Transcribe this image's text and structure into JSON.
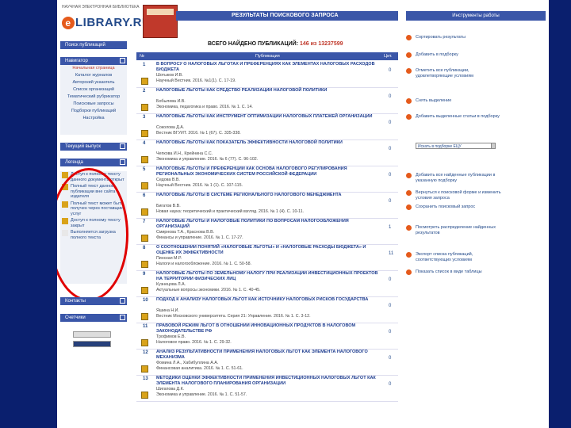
{
  "brand": {
    "tagline": "НАУЧНАЯ ЭЛЕКТРОННАЯ БИБЛИОТЕКА",
    "logo_text": "LIBRARY.RU",
    "logo_letter": "e"
  },
  "header": {
    "title": "РЕЗУЛЬТАТЫ ПОИСКОВОГО ЗАПРОСА",
    "right_title": "Инструменты работы"
  },
  "found": {
    "label": "ВСЕГО НАЙДЕНО ПУБЛИКАЦИЙ:",
    "count": "146 из 13237599"
  },
  "sidebar": {
    "search_button": "Поиск публикаций",
    "nav_button": "Навигатор",
    "nav_items": [
      {
        "label": "Начальная страница",
        "active": true
      },
      {
        "label": "Каталог журналов"
      },
      {
        "label": "Авторский указатель"
      },
      {
        "label": "Список организаций"
      },
      {
        "label": "Тематический рубрикатор"
      },
      {
        "label": "Поисковые запросы"
      },
      {
        "label": "Подборки публикаций"
      },
      {
        "label": "Настройка"
      }
    ],
    "current_button": "Текущий выпуск",
    "legend_button": "Легенда",
    "legend": [
      "Доступ к полному тексту данного документа открыт",
      "Полный текст данной публикации вне сайта издателя",
      "Полный текст может быть получен через поставщика услуг",
      "Доступ к полному тексту закрыт",
      "Выполняется загрузка полного текста"
    ],
    "contacts_button": "Контакты",
    "counter_button": "Счетчики"
  },
  "table": {
    "col_num": "№",
    "col_pub": "Публикация",
    "col_cit": "Цит.",
    "rows": [
      {
        "n": "1",
        "title": "В ВОПРОСУ О НАЛОГОВЫХ ЛЬГОТАХ И ПРЕФЕРЕНЦИЯХ КАК ЭЛЕМЕНТАХ НАЛОГОВЫХ РАСХОДОВ БЮДЖЕТА",
        "authors": "Шотыков И.В.",
        "src": "Научный Вестник. 2016. №1(1). С. 17-19.",
        "cit": "0"
      },
      {
        "n": "2",
        "title": "НАЛОГОВЫЕ ЛЬГОТЫ КАК СРЕДСТВО РЕАЛИЗАЦИИ НАЛОГОВОЙ ПОЛИТИКИ",
        "authors": "Бобылева И.В.",
        "src": "Экономика, педагогика и право. 2016. № 1. С. 14.",
        "cit": "0"
      },
      {
        "n": "3",
        "title": "НАЛОГОВЫЕ ЛЬГОТЫ КАК ИНСТРУМЕНТ ОПТИМИЗАЦИИ НАЛОГОВЫХ ПЛАТЕЖЕЙ ОРГАНИЗАЦИИ",
        "authors": "Соколова Д.А.",
        "src": "Вестник ВГУИТ. 2016. № 1 (67). С. 335-338.",
        "cit": "0"
      },
      {
        "n": "4",
        "title": "НАЛОГОВЫЕ ЛЬГОТЫ КАК ПОКАЗАТЕЛЬ ЭФФЕКТИВНОСТИ НАЛОГОВОЙ ПОЛИТИКИ",
        "authors": "Чепкова И.Н., Крейнина С.С.",
        "src": "Экономика и управление. 2016. № 6 (77). С. 96-102.",
        "cit": "0"
      },
      {
        "n": "5",
        "title": "НАЛОГОВЫЕ ЛЬГОТЫ И ПРЕФЕРЕНЦИИ КАК ОСНОВА НАЛОГОВОГО РЕГУЛИРОВАНИЯ РЕГИОНАЛЬНЫХ ЭКОНОМИЧЕСКИХ СИСТЕМ РОССИЙСКОЙ ФЕДЕРАЦИИ",
        "authors": "Седова В.В.",
        "src": "Научный Вестник. 2016. № 1 (1). С. 107-115.",
        "cit": "0"
      },
      {
        "n": "6",
        "title": "НАЛОГОВЫЕ ЛЬГОТЫ В СИСТЕМЕ РЕГИОНАЛЬНОГО НАЛОГОВОГО МЕНЕДЖМЕНТА",
        "authors": "Бигатов В.В.",
        "src": "Новая наука: теоретический и практический взгляд. 2016. № 1 (4). С. 10-11.",
        "cit": "0"
      },
      {
        "n": "7",
        "title": "НАЛОГОВЫЕ ЛЬГОТЫ И НАЛОГОВЫЕ ПОЛИТИКИ ПО ВОПРОСАМ НАЛОГООБЛОЖЕНИЯ ОРГАНИЗАЦИЙ",
        "authors": "Смирнова Т.А., Краснова В.В.",
        "src": "Финансы и управление. 2016. № 1. С. 17-27.",
        "cit": "1"
      },
      {
        "n": "8",
        "title": "О СООТНОШЕНИИ ПОНЯТИЙ «НАЛОГОВЫЕ ЛЬГОТЫ» И «НАЛОГОВЫЕ РАСХОДЫ БЮДЖЕТА» И ОЦЕНКЕ ИХ ЭФФЕКТИВНОСТИ",
        "authors": "Пинская М.Р.",
        "src": "Налоги и налогообложение. 2016. № 1. С. 50-58.",
        "cit": "11"
      },
      {
        "n": "9",
        "title": "НАЛОГОВЫЕ ЛЬГОТЫ ПО ЗЕМЕЛЬНОМУ НАЛОГУ ПРИ РЕАЛИЗАЦИИ ИНВЕСТИЦИОННЫХ ПРОЕКТОВ НА ТЕРРИТОРИИ ФИЗИЧЕСКИХ ЛИЦ",
        "authors": "Кузнецова Л.А.",
        "src": "Актуальные вопросы экономики. 2016. № 1. С. 40-45.",
        "cit": "0"
      },
      {
        "n": "10",
        "title": "ПОДХОД К АНАЛИЗУ НАЛОГОВЫХ ЛЬГОТ КАК ИСТОЧНИКУ НАЛОГОВЫХ РИСКОВ ГОСУДАРСТВА",
        "authors": "Яшина Н.И.",
        "src": "Вестник Московского университета. Серия 21: Управление. 2016. № 1. С. 3-12.",
        "cit": "0"
      },
      {
        "n": "11",
        "title": "ПРАВОВОЙ РЕЖИМ ЛЬГОТ В ОТНОШЕНИИ ИННОВАЦИОННЫХ ПРОДУКТОВ В НАЛОГОВОМ ЗАКОНОДАТЕЛЬСТВЕ РФ",
        "authors": "Трофимов Е.В.",
        "src": "Налоговое право. 2016. № 1. С. 29-32.",
        "cit": "0"
      },
      {
        "n": "12",
        "title": "АНАЛИЗ РЕЗУЛЬТАТИВНОСТИ ПРИМЕНЕНИЯ НАЛОГОВЫХ ЛЬГОТ КАК ЭЛЕМЕНТА НАЛОГОВОГО МЕХАНИЗМА",
        "authors": "Фомина Л.А., Хабибуллина А.А.",
        "src": "Финансовая аналитика. 2016. № 1. С. 51-61.",
        "cit": "0"
      },
      {
        "n": "13",
        "title": "МЕТОДИКИ ОЦЕНКИ ЭФФЕКТИВНОСТИ ПРИМЕНЕНИЯ ИНВЕСТИЦИОННЫХ НАЛОГОВЫХ ЛЬГОТ КАК ЭЛЕМЕНТА НАЛОГОВОГО ПЛАНИРОВАНИЯ ОРГАНИЗАЦИИ",
        "authors": "Шигапова Д.К.",
        "src": "Экономика и управление. 2016. № 1. С. 51-57.",
        "cit": "0"
      }
    ]
  },
  "tools": [
    {
      "label": "Сортировать результаты"
    },
    {
      "label": "Добавить в подборку"
    },
    {
      "label": "Отметить все публикации, удовлетворяющие условиям"
    },
    {
      "label": "Снять выделение"
    },
    {
      "label": "Добавить выделенные статьи в подборку"
    },
    {
      "label": "Искать в подборках",
      "select": "Искать в подборке ЕЦУ"
    },
    {
      "label": "Добавить все найденные публикации в указанную подборку"
    },
    {
      "label": "Вернуться к поисковой форме и изменить условия запроса"
    },
    {
      "label": "Сохранить поисковый запрос"
    },
    {
      "label": "Посмотреть распределение найденных результатов"
    },
    {
      "label": "Экспорт списка публикаций, соответствующих условиям"
    },
    {
      "label": "Показать список в виде таблицы"
    }
  ]
}
